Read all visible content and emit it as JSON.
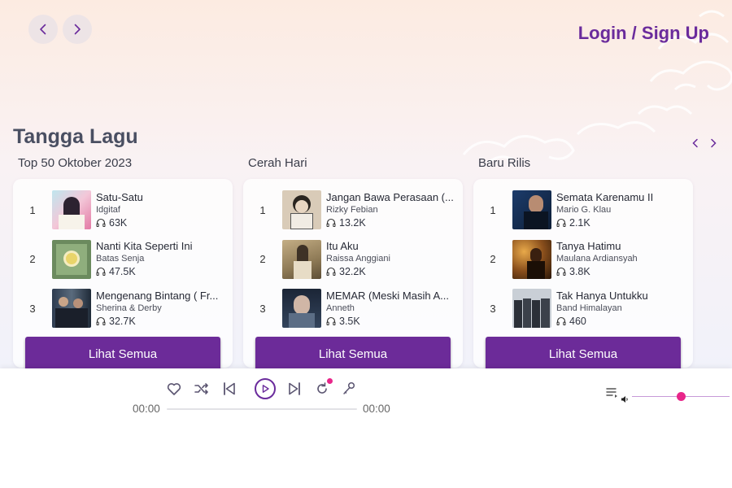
{
  "header": {
    "login_label": "Login / Sign Up"
  },
  "section": {
    "title": "Tangga Lagu"
  },
  "columns": [
    {
      "title": "Top 50 Oktober 2023",
      "see_all": "Lihat Semua",
      "tracks": [
        {
          "rank": "1",
          "title": "Satu-Satu",
          "artist": "Idgitaf",
          "plays": "63K"
        },
        {
          "rank": "2",
          "title": "Nanti Kita Seperti Ini",
          "artist": "Batas Senja",
          "plays": "47.5K"
        },
        {
          "rank": "3",
          "title": "Mengenang Bintang ( Fr...",
          "artist": "Sherina & Derby",
          "plays": "32.7K"
        }
      ]
    },
    {
      "title": "Cerah Hari",
      "see_all": "Lihat Semua",
      "tracks": [
        {
          "rank": "1",
          "title": "Jangan Bawa Perasaan (...",
          "artist": "Rizky Febian",
          "plays": "13.2K"
        },
        {
          "rank": "2",
          "title": "Itu Aku",
          "artist": "Raissa Anggiani",
          "plays": "32.2K"
        },
        {
          "rank": "3",
          "title": "MEMAR (Meski Masih A...",
          "artist": "Anneth",
          "plays": "3.5K"
        }
      ]
    },
    {
      "title": "Baru Rilis",
      "see_all": "Lihat Semua",
      "tracks": [
        {
          "rank": "1",
          "title": "Semata Karenamu II",
          "artist": "Mario G. Klau",
          "plays": "2.1K"
        },
        {
          "rank": "2",
          "title": "Tanya Hatimu",
          "artist": "Maulana Ardiansyah",
          "plays": "3.8K"
        },
        {
          "rank": "3",
          "title": "Tak Hanya Untukku",
          "artist": "Band Himalayan",
          "plays": "460"
        }
      ]
    }
  ],
  "player": {
    "current_time": "00:00",
    "duration": "00:00",
    "progress": 0,
    "volume": 0.5
  },
  "colors": {
    "accent": "#6c2b99",
    "highlight": "#e8268a"
  },
  "icons": {
    "back": "chevron-left-icon",
    "forward": "chevron-right-icon",
    "plays": "headphones-icon",
    "like": "heart-icon",
    "shuffle": "shuffle-icon",
    "prev": "skip-back-icon",
    "play": "play-icon",
    "next": "skip-forward-icon",
    "repeat": "repeat-icon",
    "mic": "microphone-icon",
    "queue": "queue-list-icon",
    "volume": "volume-icon"
  }
}
